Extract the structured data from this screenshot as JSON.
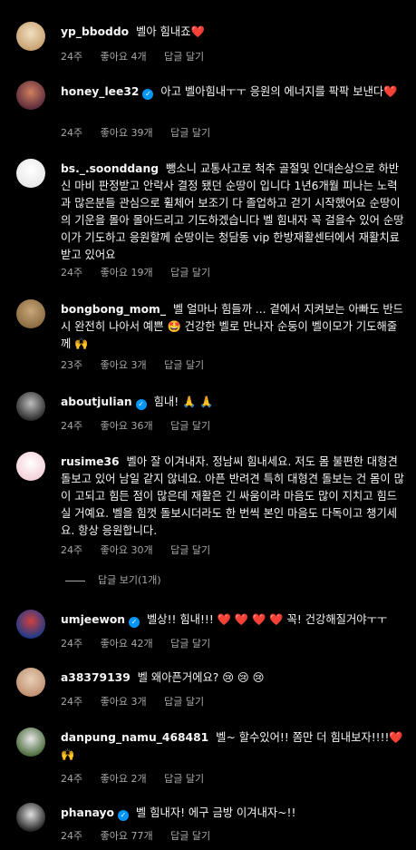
{
  "comments": [
    {
      "user": "yp_bboddo",
      "verified": false,
      "text": "벨아 힘내죠❤️",
      "time": "24주",
      "likes": "좋아요 4개",
      "reply": "답글 달기",
      "avatar_colors": [
        "#c8a070",
        "#f0e0c0"
      ]
    },
    {
      "user": "honey_lee32",
      "verified": true,
      "text": "아고 벨아힘내ㅜㅜ 응원의 에너지를 팍팍 보낸다❤️",
      "time": "24주",
      "likes": "좋아요 39개",
      "reply": "답글 달기",
      "avatar_colors": [
        "#5a2a3a",
        "#d08060"
      ]
    },
    {
      "user": "bs._.soonddang",
      "verified": false,
      "text": "뺑소니 교통사고로 척추 골절및 인대손상으로 하반신 마비 판정받고 안락사 결정 됐던 순땅이 입니다 1년6개월 피나는 노력과 많은분들 관심으로 휠체어 보조기 다 졸업하고 걷기 시작했어요 순땅이의 기운을 몰아 몰아드리고 기도하겠습니다 벨 힘내자 꼭 걸을수 있어 순땅이가 기도하고 응원할께 순땅이는 청담동 vip 한방재활센터에서 재활치료 받고 있어요",
      "time": "24주",
      "likes": "좋아요 19개",
      "reply": "답글 달기",
      "avatar_colors": [
        "#e8e8e8",
        "#ffffff"
      ]
    },
    {
      "user": "bongbong_mom_",
      "verified": false,
      "text": "벨 얼마나 힘들까 ... 곁에서 지켜보는 아빠도 반드시 완전히 나아서 예쁜 🤩 건강한 벨로 만나자 순둥이 벨이모가 기도해줄께 🙌",
      "time": "23주",
      "likes": "좋아요 3개",
      "reply": "답글 달기",
      "avatar_colors": [
        "#8a6a40",
        "#c8a878"
      ]
    },
    {
      "user": "aboutjulian",
      "verified": true,
      "text": "힘내! 🙏 🙏",
      "time": "24주",
      "likes": "좋아요 36개",
      "reply": "답글 달기",
      "avatar_colors": [
        "#2a2a2a",
        "#bdbdbd"
      ]
    },
    {
      "user": "rusime36",
      "verified": false,
      "text": "벨아 잘 이겨내자. 정남씨 힘내세요. 저도 몸 불편한 대형견 돌보고 있어 남일 같지 않네요. 아픈 반려견 특히 대형견 돌보는 건 몸이 많이 고되고 힘든 점이 많은데 재활은 긴 싸움이라 마음도 많이 지치고 힘드실 거예요. 벨을 힘껏 돌보시더라도 한 번씩 본인 마음도 다독이고 챙기세요. 항상 응원합니다.",
      "time": "24주",
      "likes": "좋아요 30개",
      "reply": "답글 달기",
      "avatar_colors": [
        "#f4d0d8",
        "#ffffff"
      ]
    },
    {
      "user": "umjeewon",
      "verified": true,
      "text": "벨상!! 힘내!!! ❤️ ❤️ ❤️ ❤️ 꼭! 건강해질거야ㅜㅜ",
      "time": "24주",
      "likes": "좋아요 42개",
      "reply": "답글 달기",
      "avatar_colors": [
        "#1a3a8a",
        "#d04040"
      ]
    },
    {
      "user": "a38379139",
      "verified": false,
      "text": "벨 왜아픈거에요? 😢 😢 😢",
      "time": "24주",
      "likes": "좋아요 3개",
      "reply": "답글 달기",
      "avatar_colors": [
        "#c09070",
        "#e8d0b8"
      ]
    },
    {
      "user": "danpung_namu_468481",
      "verified": false,
      "text": "벨~ 할수있어!! 쫌만 더 힘내보자!!!!❤️🙌",
      "time": "24주",
      "likes": "좋아요 2개",
      "reply": "답글 달기",
      "avatar_colors": [
        "#4a6a3a",
        "#e8e8e8"
      ]
    },
    {
      "user": "phanayo",
      "verified": true,
      "text": "벨 힘내자! 에구 금방 이겨내자~!!",
      "time": "24주",
      "likes": "좋아요 77개",
      "reply": "답글 달기",
      "avatar_colors": [
        "#202020",
        "#e0e0e0"
      ]
    }
  ],
  "view_replies": "답글 보기(1개)",
  "icons": {
    "verified": "verified-badge-icon"
  }
}
